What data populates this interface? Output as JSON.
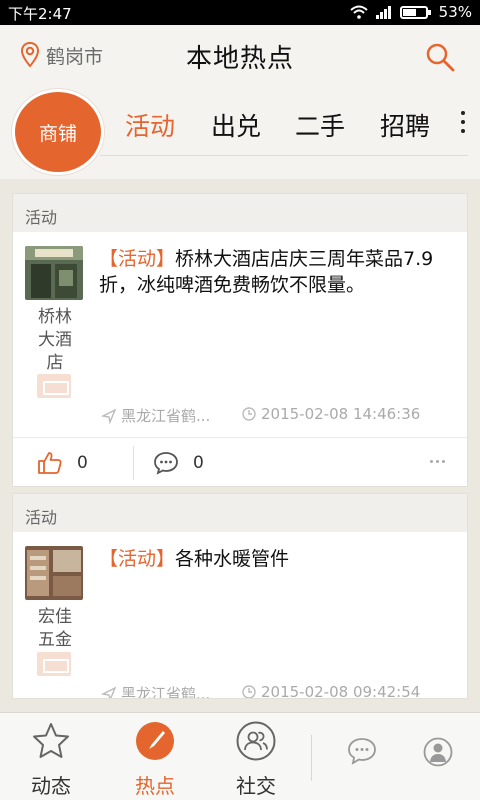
{
  "status_bar": {
    "time": "下午2:47",
    "battery": "53%"
  },
  "header": {
    "city": "鹤岗市",
    "title": "本地热点"
  },
  "categories": {
    "main_button": "商铺",
    "tabs": [
      "活动",
      "出兑",
      "二手",
      "招聘"
    ],
    "active_tab": "活动"
  },
  "posts": [
    {
      "category": "活动",
      "type_tag": "【活动】",
      "text": "桥林大酒店店庆三周年菜品7.9折，冰纯啤酒免费畅饮不限量。",
      "shop_name": "桥林大酒店",
      "location": "黑龙江省鹤...",
      "time": "2015-02-08 14:46:36",
      "likes": "0",
      "comments": "0"
    },
    {
      "category": "活动",
      "type_tag": "【活动】",
      "text": "各种水暖管件",
      "shop_name": "宏佳五金",
      "location": "黑龙江省鹤...",
      "time": "2015-02-08 09:42:54"
    }
  ],
  "bottom_nav": {
    "items": [
      "动态",
      "热点",
      "社交"
    ],
    "active": "热点"
  },
  "colors": {
    "accent": "#e4652e",
    "background": "#ebe8df"
  },
  "icons": [
    "wifi-icon",
    "signal-icon",
    "battery-icon",
    "location-pin-icon",
    "search-icon",
    "send-location-icon",
    "clock-icon",
    "thumbs-up-icon",
    "comment-icon",
    "more-dots-icon",
    "star-icon",
    "compass-icon",
    "people-icon",
    "chat-icon",
    "person-icon"
  ]
}
